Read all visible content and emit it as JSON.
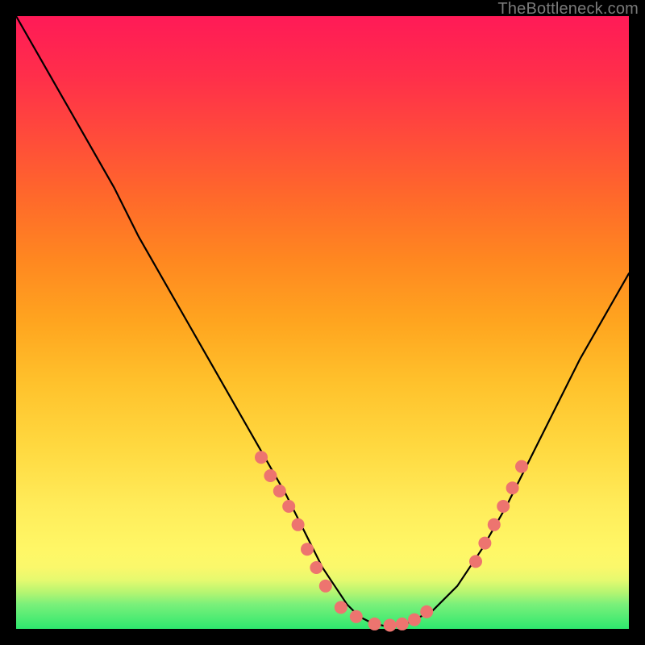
{
  "watermark": "TheBottleneck.com",
  "chart_data": {
    "type": "line",
    "title": "",
    "xlabel": "",
    "ylabel": "",
    "xlim": [
      0,
      100
    ],
    "ylim": [
      0,
      100
    ],
    "grid": false,
    "series": [
      {
        "name": "curve",
        "stroke": "#000000",
        "stroke_width": 2.2,
        "x": [
          0,
          4,
          8,
          12,
          16,
          20,
          24,
          28,
          32,
          36,
          40,
          44,
          48,
          50,
          52,
          54,
          56,
          58,
          60,
          62,
          64,
          68,
          72,
          76,
          80,
          84,
          88,
          92,
          96,
          100
        ],
        "y": [
          100,
          93,
          86,
          79,
          72,
          64,
          57,
          50,
          43,
          36,
          29,
          22,
          14,
          10,
          7,
          4,
          2,
          1,
          0.5,
          0.5,
          1,
          3,
          7,
          13,
          20,
          28,
          36,
          44,
          51,
          58
        ]
      }
    ],
    "markers": [
      {
        "name": "left-descent-markers",
        "color": "#ed746f",
        "radius": 8,
        "points": [
          {
            "x": 40.0,
            "y": 28.0
          },
          {
            "x": 41.5,
            "y": 25.0
          },
          {
            "x": 43.0,
            "y": 22.5
          },
          {
            "x": 44.5,
            "y": 20.0
          },
          {
            "x": 46.0,
            "y": 17.0
          },
          {
            "x": 47.5,
            "y": 13.0
          },
          {
            "x": 49.0,
            "y": 10.0
          },
          {
            "x": 50.5,
            "y": 7.0
          }
        ]
      },
      {
        "name": "floor-markers",
        "color": "#ed746f",
        "radius": 8,
        "points": [
          {
            "x": 53.0,
            "y": 3.5
          },
          {
            "x": 55.5,
            "y": 2.0
          },
          {
            "x": 58.5,
            "y": 0.8
          },
          {
            "x": 61.0,
            "y": 0.6
          },
          {
            "x": 63.0,
            "y": 0.8
          },
          {
            "x": 65.0,
            "y": 1.5
          },
          {
            "x": 67.0,
            "y": 2.8
          }
        ]
      },
      {
        "name": "right-ascent-markers",
        "color": "#ed746f",
        "radius": 8,
        "points": [
          {
            "x": 75.0,
            "y": 11.0
          },
          {
            "x": 76.5,
            "y": 14.0
          },
          {
            "x": 78.0,
            "y": 17.0
          },
          {
            "x": 79.5,
            "y": 20.0
          },
          {
            "x": 81.0,
            "y": 23.0
          },
          {
            "x": 82.5,
            "y": 26.5
          }
        ]
      }
    ]
  }
}
